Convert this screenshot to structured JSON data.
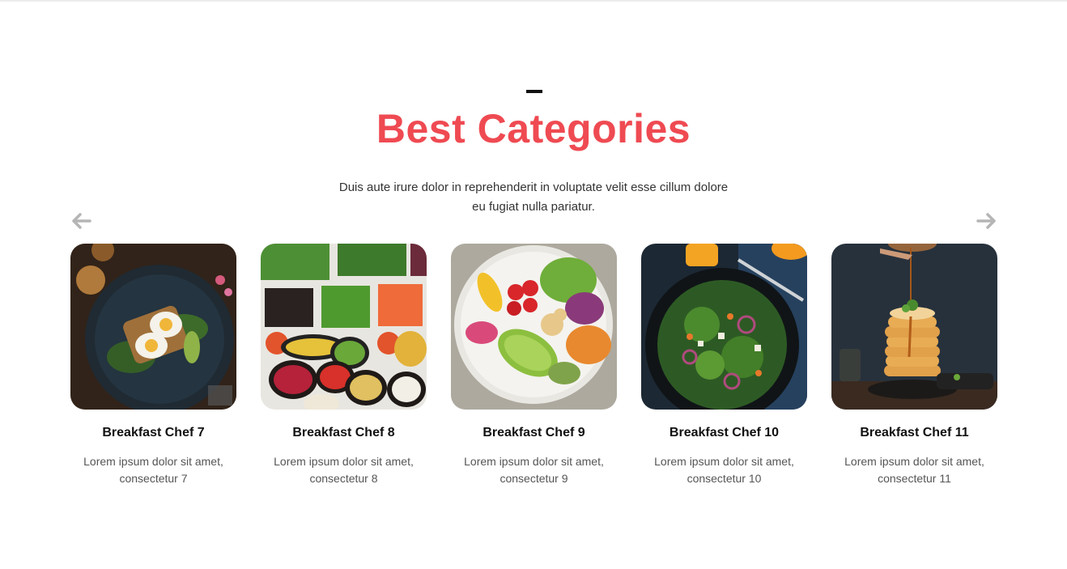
{
  "section": {
    "title": "Best Categories",
    "subtitle": "Duis aute irure dolor in reprehenderit in voluptate velit esse cillum dolore eu fugiat nulla pariatur.",
    "accent_color": "#ef4a52"
  },
  "navigation": {
    "prev_icon": "arrow-left-icon",
    "next_icon": "arrow-right-icon"
  },
  "cards": [
    {
      "title": "Breakfast Chef 7",
      "description": "Lorem ipsum dolor sit amet, consectetur 7",
      "image": "egg-avocado-toast-plate"
    },
    {
      "title": "Breakfast Chef 8",
      "description": "Lorem ipsum dolor sit amet, consectetur 8",
      "image": "vegetable-bowls-spread"
    },
    {
      "title": "Breakfast Chef 9",
      "description": "Lorem ipsum dolor sit amet, consectetur 9",
      "image": "buddha-bowl-avocado"
    },
    {
      "title": "Breakfast Chef 10",
      "description": "Lorem ipsum dolor sit amet, consectetur 10",
      "image": "salad-dark-plate"
    },
    {
      "title": "Breakfast Chef 11",
      "description": "Lorem ipsum dolor sit amet, consectetur 11",
      "image": "pancake-stack-syrup"
    }
  ]
}
